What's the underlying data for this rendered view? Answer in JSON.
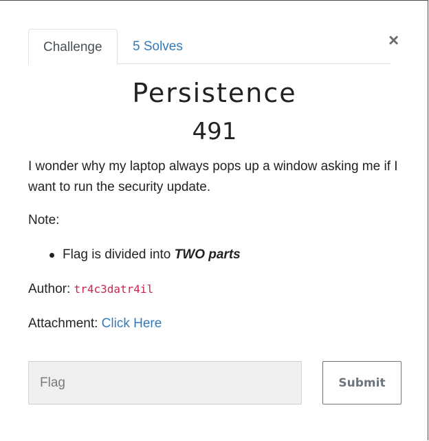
{
  "tabs": {
    "challenge_label": "Challenge",
    "solves_label": "5 Solves"
  },
  "close_glyph": "×",
  "challenge": {
    "name": "Persistence",
    "value": "491",
    "description": "I wonder why my laptop always pops up a window asking me if I want to run the security update.",
    "note_label": "Note:",
    "note_item_prefix": "Flag is divided into ",
    "note_item_emphasis": "TWO parts",
    "author_label": "Author: ",
    "author_name": "tr4c3datr4il",
    "attachment_label": "Attachment: ",
    "attachment_link": "Click Here"
  },
  "form": {
    "flag_placeholder": "Flag",
    "flag_value": "",
    "submit_label": "Submit"
  },
  "colors": {
    "link": "#337ab7",
    "code": "#c7254e",
    "input_bg": "#efefef",
    "button_border": "#6c757d"
  }
}
